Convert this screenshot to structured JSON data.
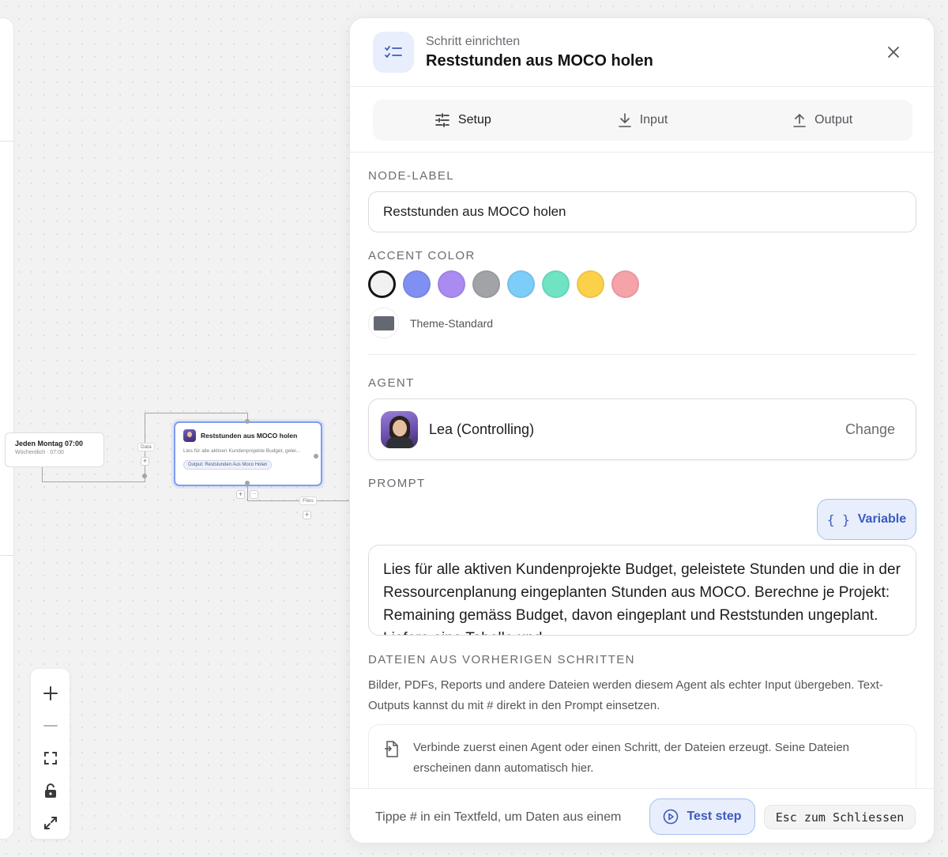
{
  "canvas": {
    "trigger_node": {
      "title": "Jeden Montag 07:00",
      "subtitle": "Wöchentlich · 07:00"
    },
    "main_node": {
      "title": "Reststunden aus MOCO holen",
      "description": "Lies für alle aktiven Kundenprojekte Budget, gelei...",
      "output_chip": "Output: Reststunden Aus Moco Holen"
    },
    "edge_labels": {
      "data": "Data",
      "files": "Files"
    },
    "add_symbol": "+",
    "more_symbol": "···"
  },
  "zoom_controls": [
    "zoom-in",
    "zoom-out",
    "fit-view",
    "lock",
    "fullscreen"
  ],
  "panel": {
    "subtitle": "Schritt einrichten",
    "title": "Reststunden aus MOCO holen",
    "tabs": [
      {
        "label": "Setup",
        "icon": "sliders-icon",
        "active": true
      },
      {
        "label": "Input",
        "icon": "download-icon",
        "active": false
      },
      {
        "label": "Output",
        "icon": "upload-icon",
        "active": false
      }
    ],
    "node_label": {
      "label": "NODE-LABEL",
      "value": "Reststunden aus MOCO holen"
    },
    "accent": {
      "label": "ACCENT COLOR",
      "swatches": [
        "#f1f1f2",
        "#7f90f2",
        "#a98bf2",
        "#a2a3a6",
        "#7ccdf8",
        "#6fe3c4",
        "#fcd14a",
        "#f5a3a8"
      ],
      "selected_index": 0,
      "theme_label": "Theme-Standard",
      "theme_color": "#646873"
    },
    "agent": {
      "label": "AGENT",
      "name": "Lea (Controlling)",
      "change_label": "Change"
    },
    "prompt": {
      "label": "PROMPT",
      "variable_button": "Variable",
      "variable_icon": "{ }",
      "text": "Lies für alle aktiven Kundenprojekte Budget, geleistete Stunden und die in der Ressourcenplanung eingeplanten Stunden aus MOCO. Berechne je Projekt: Remaining gemäss Budget, davon eingeplant und Reststunden ungeplant. Liefere eine Tabelle und"
    },
    "files": {
      "label": "DATEIEN AUS VORHERIGEN SCHRITTEN",
      "description": "Bilder, PDFs, Reports und andere Dateien werden diesem Agent als echter Input übergeben. Text-Outputs kannst du mit # direkt in den Prompt einsetzen.",
      "empty_text": "Verbinde zuerst einen Agent oder einen Schritt, der Dateien erzeugt. Seine Dateien erscheinen dann automatisch hier."
    },
    "footer": {
      "hint": "Tippe # in ein Textfeld, um Daten aus einem",
      "test_button": "Test step",
      "esc_label": "Esc zum Schliessen"
    }
  },
  "colors": {
    "accent_blue": "#3b5bbd",
    "accent_bg": "#e8eefc",
    "node_border": "#7e9cf0"
  }
}
